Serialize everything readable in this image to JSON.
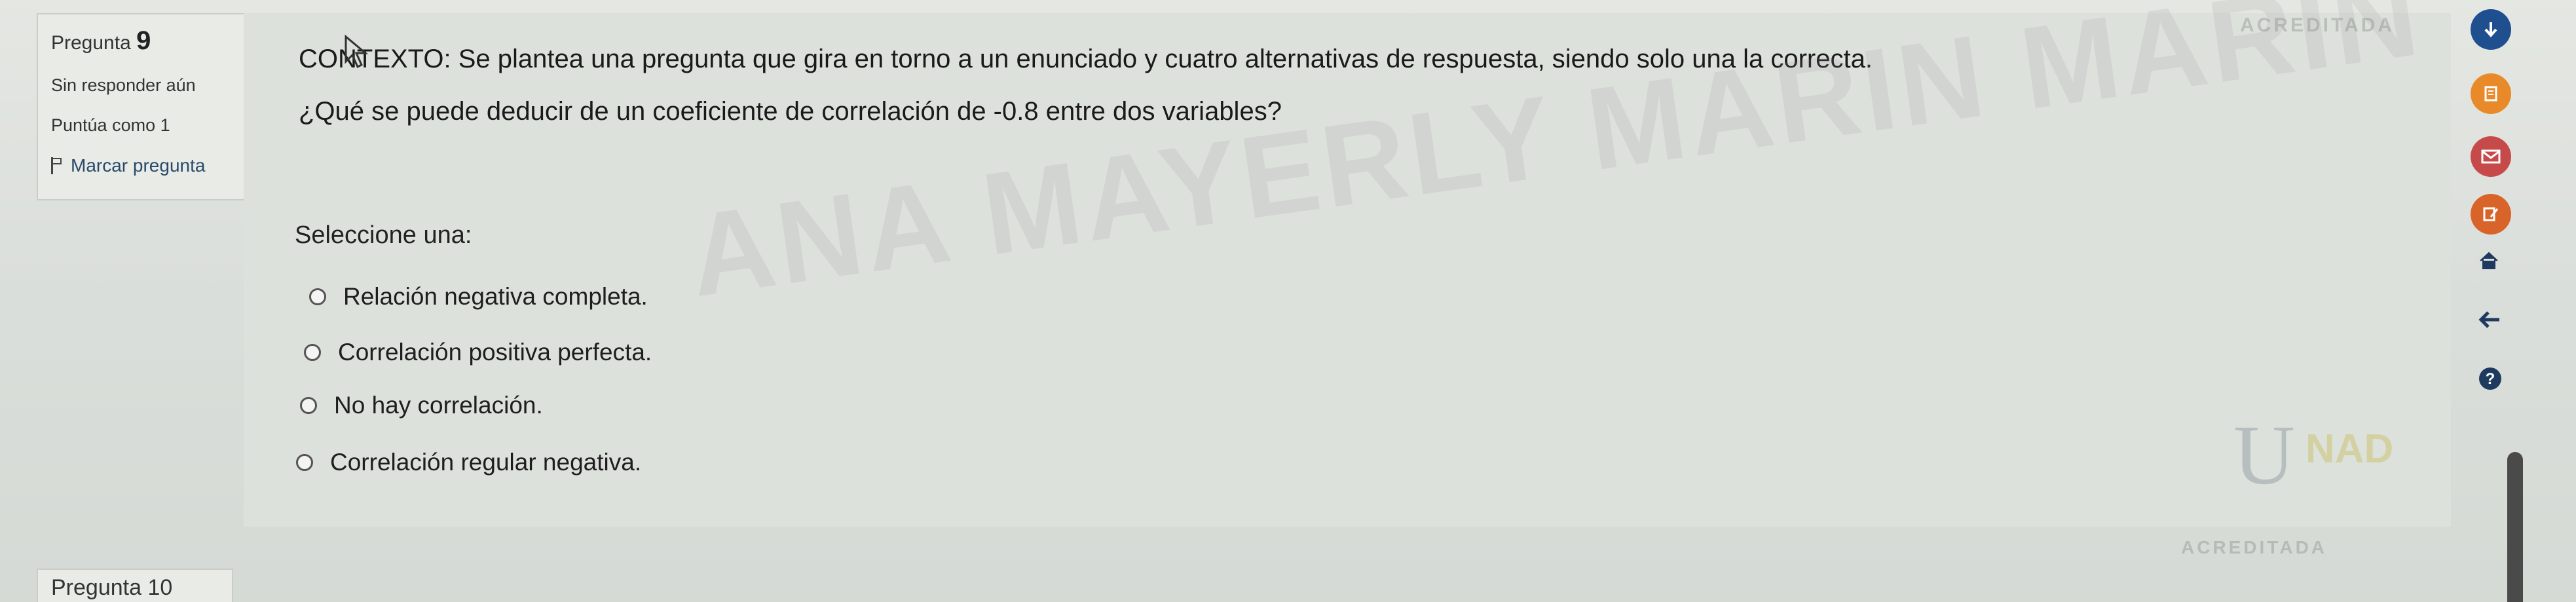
{
  "question_info": {
    "number_label": "Pregunta",
    "number": "9",
    "status": "Sin responder aún",
    "score": "Puntúa como 1",
    "flag_label": "Marcar pregunta"
  },
  "question": {
    "context": "CONTEXTO: Se plantea una pregunta que gira en torno a un enunciado y cuatro alternativas de respuesta, siendo solo una la correcta.",
    "prompt": "¿Qué se puede deducir de un coeficiente de correlación de -0.8 entre dos variables?",
    "select_label": "Seleccione una:",
    "options": [
      {
        "label": "Relación negativa completa."
      },
      {
        "label": "Correlación positiva perfecta."
      },
      {
        "label": "No hay correlación."
      },
      {
        "label": "Correlación regular negativa."
      }
    ]
  },
  "watermark": "ANA MAYERLY MARIN MARIN",
  "branding": {
    "acreditada_top": "ACREDITADA",
    "acreditada_bottom": "ACREDITADA",
    "logo_u": "U",
    "logo_ad": "NAD"
  },
  "next_question": {
    "label": "Pregunta 10"
  },
  "sidebar_icons": [
    "down-icon",
    "notes-icon",
    "mail-icon",
    "edit-icon",
    "home-icon",
    "back-arrow-icon",
    "help-icon"
  ]
}
